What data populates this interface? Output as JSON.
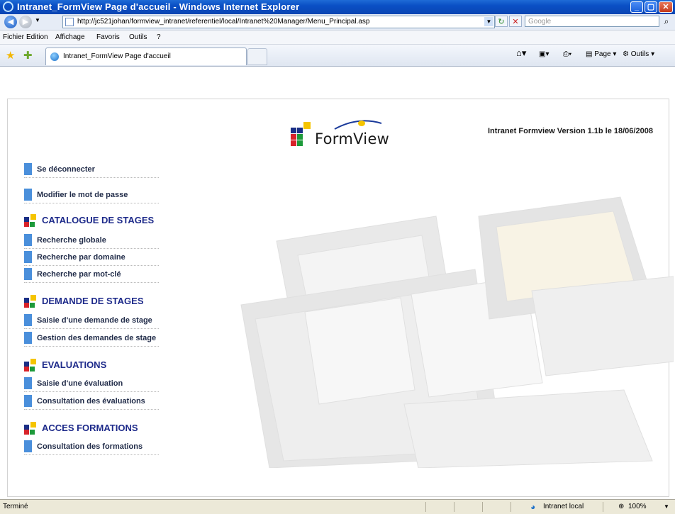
{
  "window": {
    "title": "Intranet_FormView Page d'accueil - Windows Internet Explorer"
  },
  "addressbar": {
    "url": "http://jc521johan/formview_intranet/referentiel/local/Intranet%20Manager/Menu_Principal.asp",
    "search_placeholder": "Google"
  },
  "menubar": {
    "items": [
      "Fichier",
      "Edition",
      "Affichage",
      "Favoris",
      "Outils",
      "?"
    ]
  },
  "tabs": [
    {
      "label": "Intranet_FormView Page d'accueil"
    }
  ],
  "tools": {
    "page": "Page",
    "outils": "Outils"
  },
  "page": {
    "logo_text": "FormView",
    "version": "Intranet Formview Version 1.1b le 18/06/2008",
    "links_top": [
      "Se déconnecter",
      "Modifier le mot de passe"
    ],
    "sections": [
      {
        "title": "CATALOGUE DE STAGES",
        "links": [
          "Recherche globale",
          "Recherche par domaine",
          "Recherche par mot-clé"
        ]
      },
      {
        "title": "DEMANDE DE STAGES",
        "links": [
          "Saisie d'une demande de stage",
          "Gestion des demandes de stage"
        ]
      },
      {
        "title": "EVALUATIONS",
        "links": [
          "Saisie d'une évaluation",
          "Consultation des évaluations"
        ]
      },
      {
        "title": "ACCES FORMATIONS",
        "links": [
          "Consultation des formations"
        ]
      }
    ]
  },
  "statusbar": {
    "status": "Terminé",
    "zone": "Intranet local",
    "zoom": "100%"
  },
  "colors": {
    "link_bar": "#4a8fdb",
    "section_title": "#1d2a8a",
    "titlebar": "#0b46b3",
    "icon_red": "#d8232a",
    "icon_yellow": "#f5c400",
    "icon_green": "#1d9a3a",
    "icon_blue": "#1a2f86"
  }
}
